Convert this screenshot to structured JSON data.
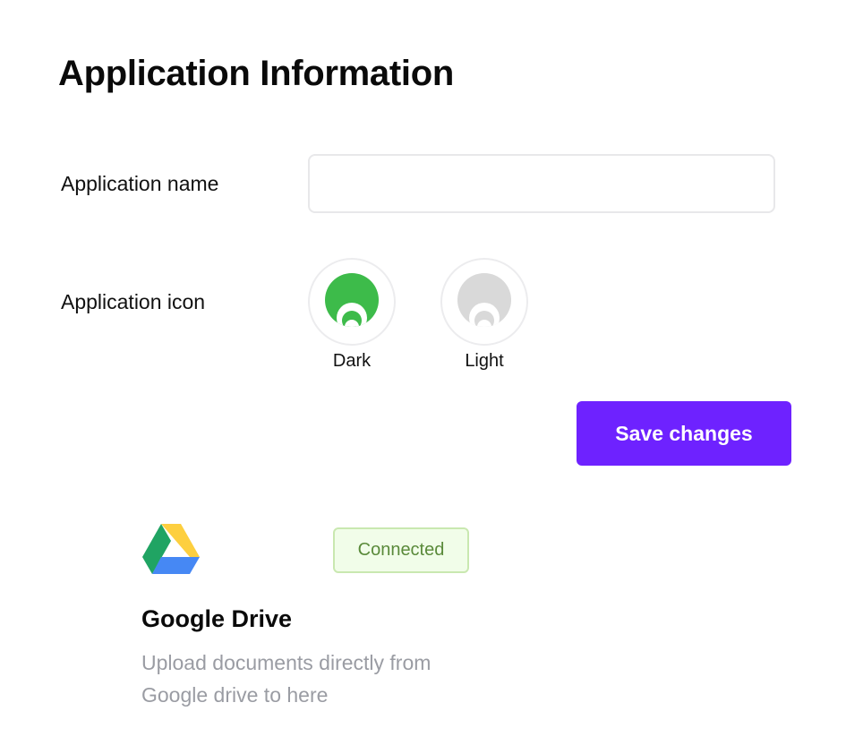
{
  "header": {
    "title": "Application Information"
  },
  "form": {
    "name_label": "Application name",
    "name_value": "",
    "name_placeholder": "",
    "icon_label": "Application icon",
    "icon_options": [
      {
        "label": "Dark",
        "icon": "dark-app-icon",
        "color": "#3dbb4a"
      },
      {
        "label": "Light",
        "icon": "light-app-icon",
        "color": "#d9d9d9"
      }
    ],
    "save_label": "Save changes"
  },
  "integration": {
    "icon": "google-drive-icon",
    "status": "Connected",
    "title": "Google Drive",
    "description": "Upload documents directly from Google drive to here"
  },
  "colors": {
    "accent": "#6e22ff",
    "connected_bg": "#f1fde9",
    "connected_border": "#c9e8b0",
    "connected_text": "#5a8a3a",
    "muted_text": "#9a9ca3"
  }
}
